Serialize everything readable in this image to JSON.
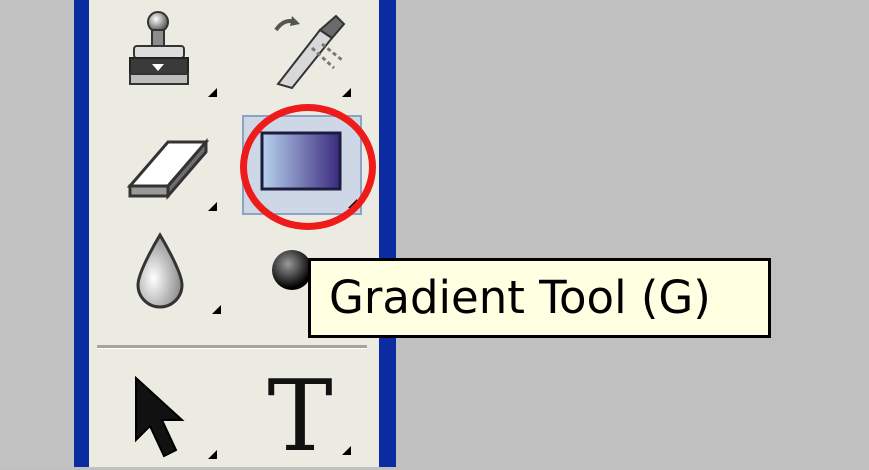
{
  "tooltip": {
    "text": "Gradient Tool (G)"
  },
  "tools": [
    {
      "name": "clone-stamp",
      "icon": "stamp-icon"
    },
    {
      "name": "history-brush",
      "icon": "history-brush-icon"
    },
    {
      "name": "eraser",
      "icon": "eraser-icon"
    },
    {
      "name": "gradient",
      "icon": "gradient-icon",
      "selected": true
    },
    {
      "name": "blur",
      "icon": "water-drop-icon"
    },
    {
      "name": "burn",
      "icon": "burn-icon"
    },
    {
      "name": "path-selection",
      "icon": "arrow-cursor-icon"
    },
    {
      "name": "type",
      "icon": "type-icon",
      "glyph": "T"
    }
  ],
  "colors": {
    "panel_border": "#0a2ca0",
    "highlight_ring": "#ee1b1b",
    "tooltip_bg": "#ffffe1"
  }
}
